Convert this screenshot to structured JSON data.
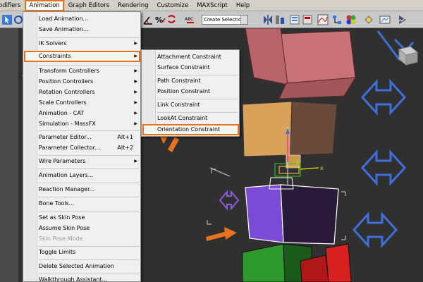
{
  "menubar": {
    "items": [
      "odifiers",
      "Animation",
      "Graph Editors",
      "Rendering",
      "Customize",
      "MAXScript",
      "Help"
    ]
  },
  "toolbar": {
    "selection_set_placeholder": "Create Selection Se",
    "icons": [
      "select-icon",
      "rotate-icon",
      "snap-3d-icon",
      "angle-snap-icon",
      "percent-snap-icon",
      "spinner-snap-icon",
      "edit-named-sets-icon",
      "mirror-icon",
      "align-icon",
      "layer-icon",
      "ribbon-icon",
      "curve-editor-icon",
      "schematic-icon",
      "material-editor-icon",
      "render-setup-icon",
      "render-frame-icon",
      "render-icon"
    ]
  },
  "animation_menu": {
    "items": [
      {
        "label": "Load Animation..."
      },
      {
        "label": "Save Animation..."
      },
      {
        "label": "IK Solvers",
        "submenu": true
      },
      {
        "label": "Constraints",
        "submenu": true,
        "highlighted": true
      },
      {
        "label": "Transform Controllers",
        "submenu": true
      },
      {
        "label": "Position Controllers",
        "submenu": true
      },
      {
        "label": "Rotation Controllers",
        "submenu": true
      },
      {
        "label": "Scale Controllers",
        "submenu": true
      },
      {
        "label": "Animation - CAT",
        "submenu": true
      },
      {
        "label": "Simulation - MassFX",
        "submenu": true
      },
      {
        "label": "Parameter Editor...",
        "shortcut": "Alt+1"
      },
      {
        "label": "Parameter Collector...",
        "shortcut": "Alt+2"
      },
      {
        "label": "Wire Parameters",
        "submenu": true
      },
      {
        "label": "Animation Layers..."
      },
      {
        "label": "Reaction Manager..."
      },
      {
        "label": "Bone Tools..."
      },
      {
        "label": "Set as Skin Pose"
      },
      {
        "label": "Assume Skin Pose"
      },
      {
        "label": "Skin Pose Mode",
        "disabled": true
      },
      {
        "label": "Toggle Limits"
      },
      {
        "label": "Delete Selected Animation"
      },
      {
        "label": "Walkthrough Assistant..."
      }
    ]
  },
  "constraints_submenu": {
    "items": [
      {
        "label": "Attachment Constraint"
      },
      {
        "label": "Surface Constraint"
      },
      {
        "label": "Path Constraint"
      },
      {
        "label": "Position Constraint"
      },
      {
        "label": "Link Constraint"
      },
      {
        "label": "LookAt Constraint"
      },
      {
        "label": "Orientation Constraint",
        "highlighted": true
      }
    ]
  },
  "viewport": {
    "axis_label_x": "x",
    "axis_label_y": "y"
  },
  "colors": {
    "highlight": "#e8731c",
    "menu_bg": "#f0f0f0",
    "viewport_bg": "#303030",
    "purple_box": "#7a4bd6",
    "pink_box": "#c97278",
    "orange_box": "#d9a25a",
    "green_box": "#2e9a2e",
    "red_box": "#d82020",
    "helper_blue": "#3f6fd8"
  }
}
